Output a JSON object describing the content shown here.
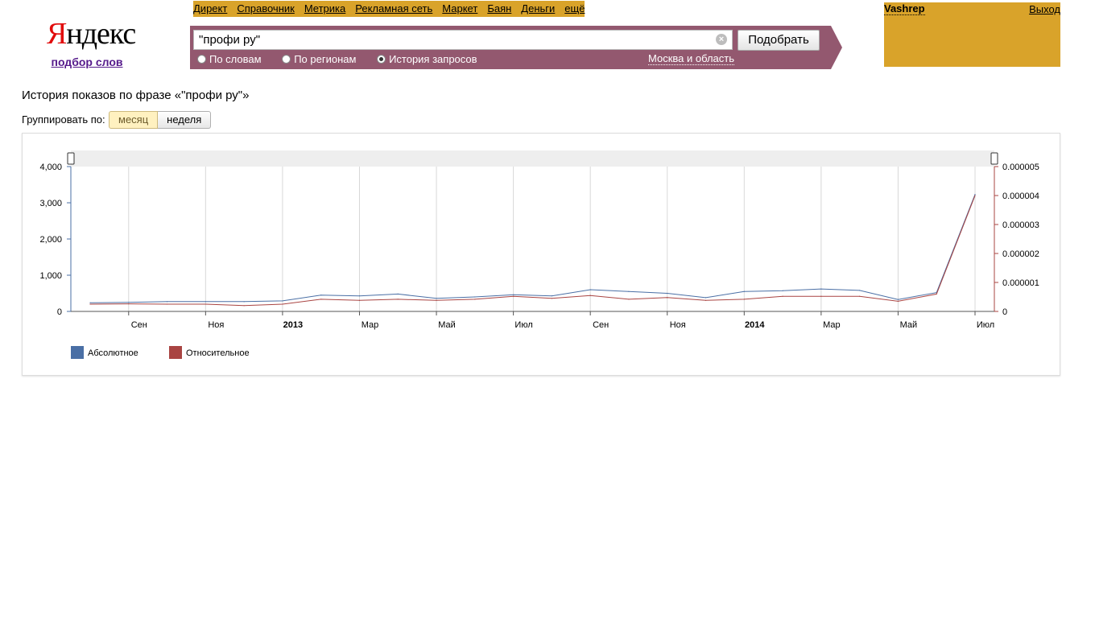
{
  "logo": {
    "wordmark_first": "Я",
    "wordmark_rest": "ндекс",
    "subtitle": "подбор слов"
  },
  "services": [
    "Директ",
    "Справочник",
    "Метрика",
    "Рекламная сеть",
    "Маркет",
    "Баян",
    "Деньги",
    "ещё"
  ],
  "search": {
    "query": "\"профи ру\"",
    "submit_label": "Подобрать",
    "modes": [
      {
        "label": "По словам",
        "selected": false
      },
      {
        "label": "По регионам",
        "selected": false
      },
      {
        "label": "История запросов",
        "selected": true
      }
    ],
    "region": "Москва и область"
  },
  "user": {
    "name": "Vashrep",
    "logout_label": "Выход"
  },
  "page": {
    "history_title": "История показов по фразе «\"профи ру\"»",
    "group_label": "Группировать по:",
    "group_options": [
      {
        "label": "месяц",
        "active": true
      },
      {
        "label": "неделя",
        "active": false
      }
    ]
  },
  "colors": {
    "absolute": "#4a6fa5",
    "relative": "#a94442",
    "accent": "#93586f",
    "brand_yellow": "#d9a32a"
  },
  "chart_data": {
    "type": "line",
    "x": [
      "2012-08",
      "2012-09",
      "2012-10",
      "2012-11",
      "2012-12",
      "2013-01",
      "2013-02",
      "2013-03",
      "2013-04",
      "2013-05",
      "2013-06",
      "2013-07",
      "2013-08",
      "2013-09",
      "2013-10",
      "2013-11",
      "2013-12",
      "2014-01",
      "2014-02",
      "2014-03",
      "2014-04",
      "2014-05",
      "2014-06",
      "2014-07"
    ],
    "x_tick_labels": [
      "Сен",
      "Ноя",
      "2013",
      "Мар",
      "Май",
      "Июл",
      "Сен",
      "Ноя",
      "2014",
      "Мар",
      "Май",
      "Июл"
    ],
    "x_tick_dates": [
      "2012-09",
      "2012-11",
      "2013-01",
      "2013-03",
      "2013-05",
      "2013-07",
      "2013-09",
      "2013-11",
      "2014-01",
      "2014-03",
      "2014-05",
      "2014-07"
    ],
    "x_tick_bold": [
      "2013",
      "2014"
    ],
    "series": [
      {
        "name": "Абсолютное",
        "axis": "left",
        "values": [
          240,
          250,
          270,
          270,
          270,
          290,
          450,
          430,
          480,
          360,
          400,
          460,
          430,
          600,
          550,
          500,
          380,
          550,
          570,
          620,
          580,
          330,
          520,
          3230
        ]
      },
      {
        "name": "Относительное",
        "axis": "right",
        "values": [
          2.5e-07,
          2.6e-07,
          2.5e-07,
          2.5e-07,
          2e-07,
          2.5e-07,
          4.2e-07,
          3.8e-07,
          4.2e-07,
          3.8e-07,
          4.2e-07,
          5.2e-07,
          4.5e-07,
          5.5e-07,
          4.2e-07,
          4.8e-07,
          3.8e-07,
          4.2e-07,
          5.2e-07,
          5.2e-07,
          5.2e-07,
          3.5e-07,
          6e-07,
          4e-06
        ]
      }
    ],
    "y_left": {
      "ylim": [
        0,
        4000
      ],
      "ticks": [
        "0",
        "1,000",
        "2,000",
        "3,000",
        "4,000"
      ]
    },
    "y_right": {
      "ylim": [
        0,
        5e-06
      ],
      "ticks": [
        "0",
        "0.000001",
        "0.000002",
        "0.000003",
        "0.000004",
        "0.000005"
      ]
    },
    "grid": true,
    "legend": "bottom-left"
  }
}
